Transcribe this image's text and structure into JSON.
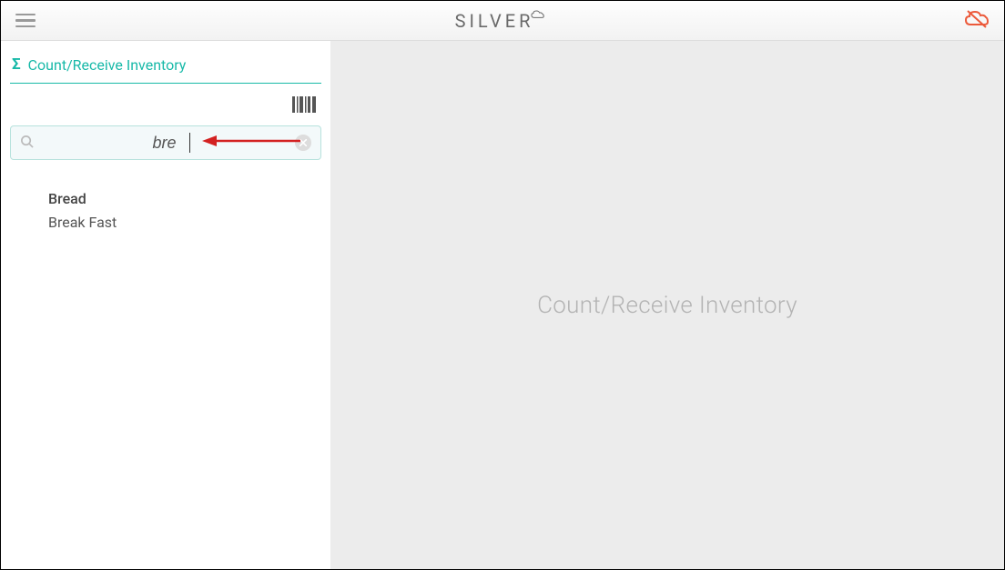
{
  "header": {
    "brand": "SILVER"
  },
  "sidebar": {
    "section_title": "Count/Receive Inventory",
    "search": {
      "value": "bre"
    },
    "results": [
      "Bread",
      "Break Fast"
    ]
  },
  "content": {
    "placeholder": "Count/Receive Inventory"
  }
}
